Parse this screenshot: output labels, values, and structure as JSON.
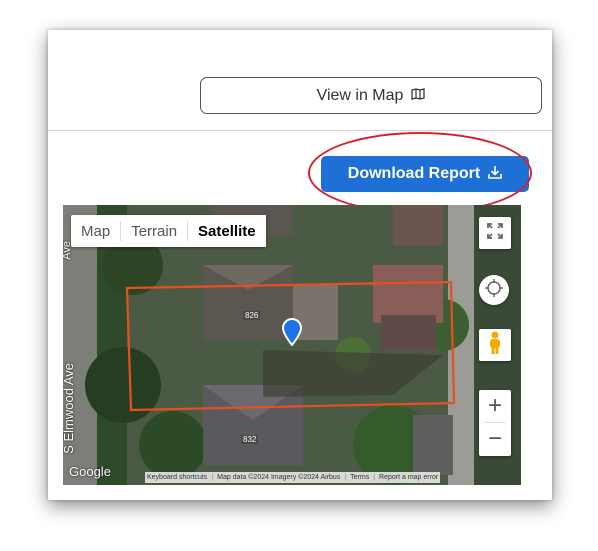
{
  "actions": {
    "view_in_map_label": "View in Map",
    "download_report_label": "Download Report"
  },
  "map": {
    "type_options": [
      "Map",
      "Terrain",
      "Satellite"
    ],
    "selected_type": "Satellite",
    "street_label": "S Elmwood Ave",
    "street_label_top": "Ave",
    "house_numbers": [
      "826",
      "832"
    ],
    "google_logo": "Google",
    "zoom_in_label": "+",
    "zoom_out_label": "−",
    "attribution": {
      "shortcuts": "Keyboard shortcuts",
      "map_data": "Map data ©2024 Imagery ©2024 Airbus",
      "terms": "Terms",
      "report": "Report a map error"
    }
  },
  "colors": {
    "primary": "#1e6fd6",
    "highlight_ellipse": "#d8202c",
    "parcel_outline": "#e8501f",
    "marker": "#1a73e8"
  },
  "icons": {
    "view_in_map": "map-icon",
    "download": "download-icon",
    "fullscreen": "fullscreen-icon",
    "location": "crosshair-icon",
    "street_view": "pegman-icon",
    "marker": "location-pin-icon"
  }
}
